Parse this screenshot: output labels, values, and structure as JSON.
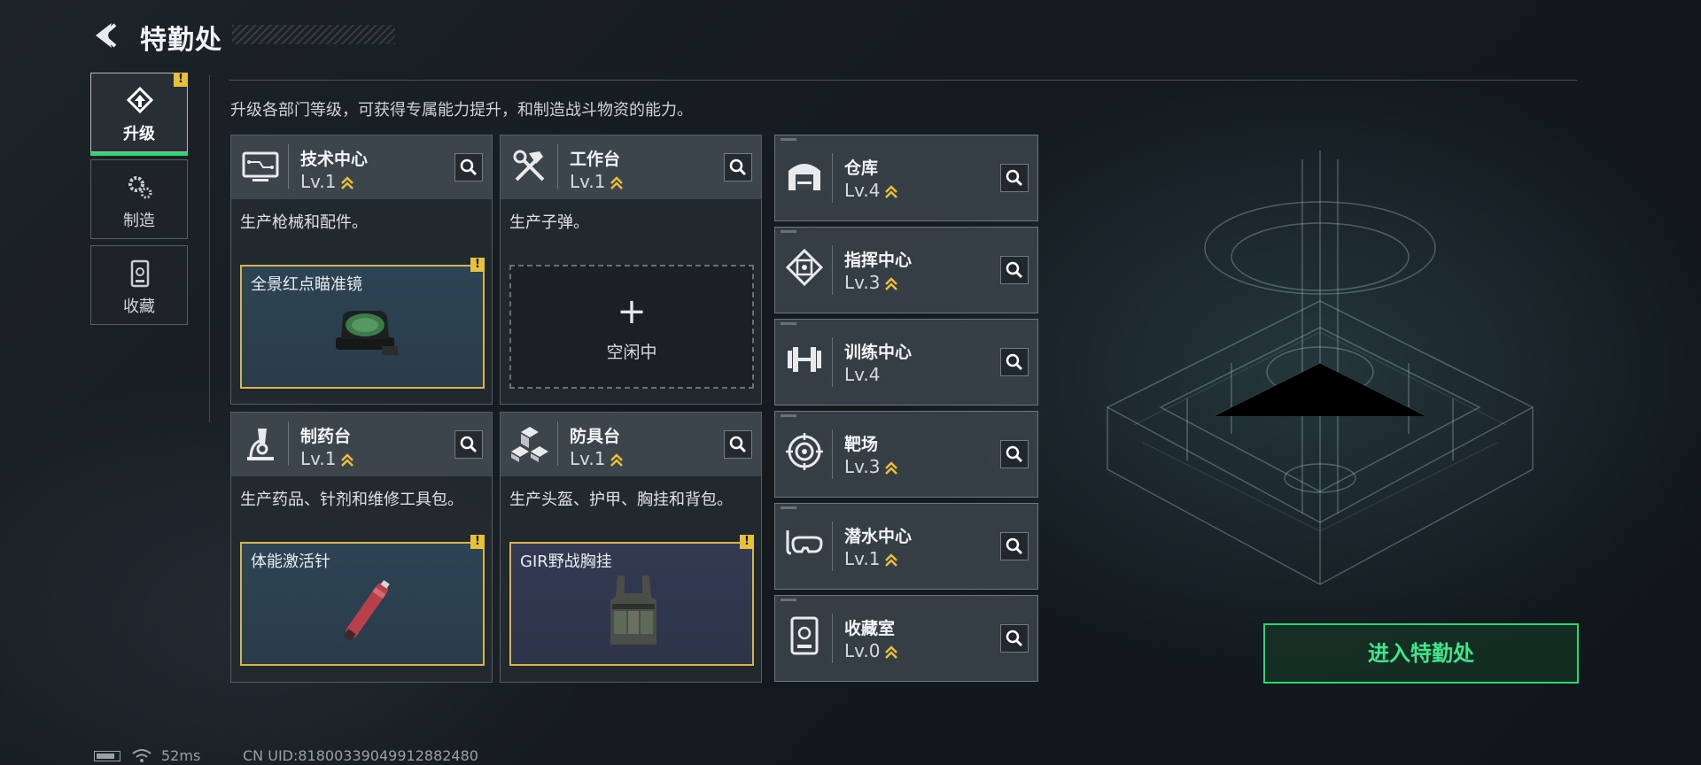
{
  "header": {
    "title": "特勤处"
  },
  "nav": {
    "items": [
      {
        "label": "升级",
        "active": true,
        "warn": "!"
      },
      {
        "label": "制造",
        "active": false
      },
      {
        "label": "收藏",
        "active": false
      }
    ]
  },
  "subtitle": "升级各部门等级，可获得专属能力提升，和制造战斗物资的能力。",
  "departments": [
    {
      "name": "技术中心",
      "level": "Lv.1",
      "desc": "生产枪械和配件。",
      "slot": {
        "name": "全景红点瞄准镜",
        "warn": "!"
      }
    },
    {
      "name": "工作台",
      "level": "Lv.1",
      "desc": "生产子弹。",
      "slot": {
        "plus": "+",
        "empty_label": "空闲中"
      }
    },
    {
      "name": "制药台",
      "level": "Lv.1",
      "desc": "生产药品、针剂和维修工具包。",
      "slot": {
        "name": "体能激活针",
        "warn": "!"
      }
    },
    {
      "name": "防具台",
      "level": "Lv.1",
      "desc": "生产头盔、护甲、胸挂和背包。",
      "slot": {
        "name": "GIR野战胸挂",
        "warn": "!"
      }
    }
  ],
  "facilities": [
    {
      "name": "仓库",
      "level": "Lv.4",
      "upgradable": true
    },
    {
      "name": "指挥中心",
      "level": "Lv.3",
      "upgradable": true
    },
    {
      "name": "训练中心",
      "level": "Lv.4",
      "upgradable": false
    },
    {
      "name": "靶场",
      "level": "Lv.3",
      "upgradable": true
    },
    {
      "name": "潜水中心",
      "level": "Lv.1",
      "upgradable": true
    },
    {
      "name": "收藏室",
      "level": "Lv.0",
      "upgradable": true
    }
  ],
  "enter_button": "进入特勤处",
  "status": {
    "ping": "52ms",
    "uid": "CN UID:8180033904991288248​0"
  },
  "colors": {
    "accent_green": "#2ed573",
    "warn_yellow": "#e8c13a",
    "slot_border": "#d7b54a"
  }
}
